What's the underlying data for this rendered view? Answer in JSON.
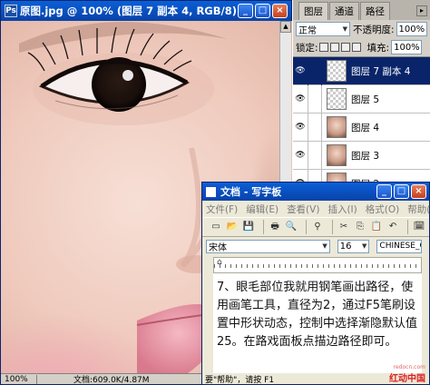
{
  "ps_window": {
    "title": "原图.jpg @ 100% (图层 7 副本 4, RGB/8)",
    "status_zoom": "100%",
    "status_doc": "文档:609.0K/4.87M"
  },
  "layers_panel": {
    "tabs": [
      "图层",
      "通道",
      "路径"
    ],
    "blend_mode": "正常",
    "opacity_label": "不透明度:",
    "opacity_value": "100%",
    "lock_label": "锁定:",
    "fill_label": "填充:",
    "fill_value": "100%",
    "layers": [
      {
        "name": "图层 7 副本 4",
        "thumb": "transparent",
        "selected": true
      },
      {
        "name": "图层 5",
        "thumb": "transparent",
        "selected": false
      },
      {
        "name": "图层 4",
        "thumb": "face",
        "selected": false
      },
      {
        "name": "图层 3",
        "thumb": "face",
        "selected": false
      },
      {
        "name": "图层 2",
        "thumb": "face",
        "selected": false
      }
    ]
  },
  "wordpad": {
    "title": "文档 - 写字板",
    "menu": [
      "文件(F)",
      "编辑(E)",
      "查看(V)",
      "插入(I)",
      "格式(O)",
      "帮助(H)"
    ],
    "font_name": "宋体",
    "font_size": "16",
    "script": "CHINESE_G",
    "body_text": "7、眼毛部位我就用钢笔画出路径，使用画笔工具，直径为2，通过F5笔刷设置中形状动态，控制中选择渐隐默认值25。在路戏面板点描边路径即可。",
    "status": "要\"帮助\"，请按 F1"
  },
  "watermark": {
    "text": "红动中国",
    "url": "redocn.com"
  }
}
